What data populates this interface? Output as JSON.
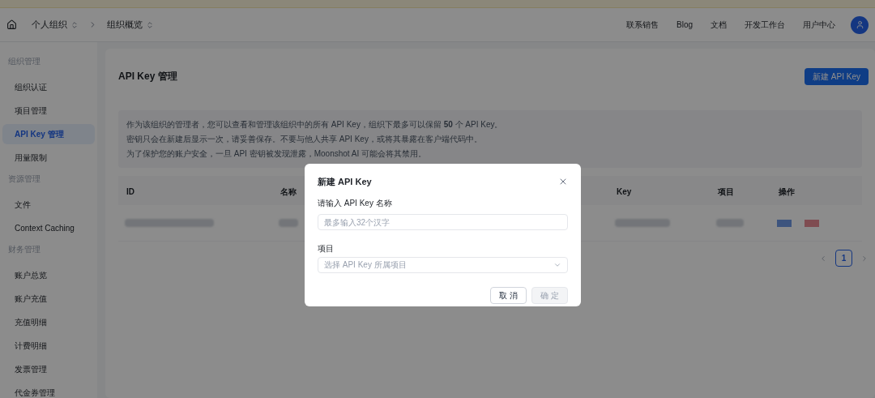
{
  "header": {
    "breadcrumbs": [
      {
        "label": "个人组织"
      },
      {
        "label": "组织概览"
      }
    ],
    "nav": [
      "联系销售",
      "Blog",
      "文档",
      "开发工作台",
      "用户中心"
    ]
  },
  "sidebar": {
    "groups": [
      {
        "title": "组织管理",
        "items": [
          {
            "label": "组织认证",
            "selected": false
          },
          {
            "label": "项目管理",
            "selected": false
          },
          {
            "label": "API Key 管理",
            "selected": true
          },
          {
            "label": "用量限制",
            "selected": false
          }
        ]
      },
      {
        "title": "资源管理",
        "items": [
          {
            "label": "文件",
            "selected": false
          },
          {
            "label": "Context Caching",
            "selected": false
          }
        ]
      },
      {
        "title": "财务管理",
        "items": [
          {
            "label": "账户总览",
            "selected": false
          },
          {
            "label": "账户充值",
            "selected": false
          },
          {
            "label": "充值明细",
            "selected": false
          },
          {
            "label": "计费明细",
            "selected": false
          },
          {
            "label": "发票管理",
            "selected": false
          },
          {
            "label": "代金券管理",
            "selected": false
          }
        ]
      }
    ]
  },
  "page": {
    "title": "API Key 管理",
    "new_button": "新建 API Key",
    "notice": [
      "作为该组织的管理者，您可以查看和管理该组织中的所有 API Key，组织下最多可以保留 **50** 个 API Key。",
      "密钥只会在新建后显示一次，请妥善保存。不要与他人共享 API Key，或将其暴露在客户端代码中。",
      "为了保护您的账户安全，一旦 API 密钥被发现泄露，Moonshot AI 可能会将其禁用。"
    ],
    "table": {
      "columns": [
        "ID",
        "名称",
        "Key",
        "项目",
        "操作"
      ]
    },
    "pagination": [
      {
        "label": "1",
        "selected": true
      }
    ]
  },
  "dialog": {
    "title": "新建 API Key",
    "fields": [
      {
        "kind": "input",
        "label": "请输入 API Key 名称",
        "placeholder": "最多输入32个汉字"
      },
      {
        "kind": "select",
        "label": "项目",
        "placeholder": "选择 API Key 所属项目"
      }
    ],
    "buttons": [
      {
        "label": "取 消",
        "disabled": false
      },
      {
        "label": "确 定",
        "disabled": true
      }
    ]
  }
}
